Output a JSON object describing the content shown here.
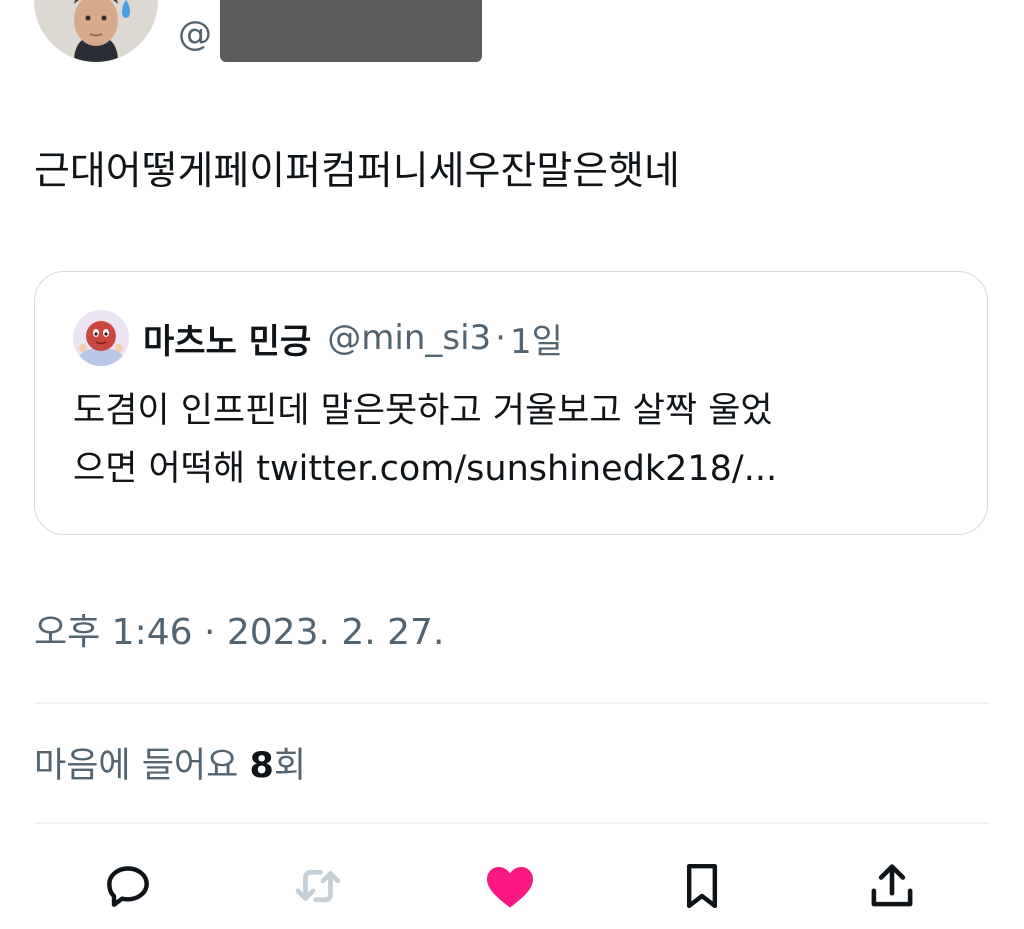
{
  "author": {
    "handle_prefix": "@",
    "avatar_icon": "person-avatar"
  },
  "tweet": {
    "text": "근대어떻게페이퍼컴퍼니세우잔말은햇네"
  },
  "quote": {
    "avatar_icon": "character-avatar",
    "display_name": "마츠노 민긍",
    "handle": "@min_si3",
    "separator": "·",
    "time": "1일",
    "body_lines": [
      "도겸이 인프핀데 말은못하고 거울보고 살짝 울었",
      "으면 어떡해 twitter.com/sunshinedk218/..."
    ]
  },
  "meta": {
    "timestamp": "오후 1:46 · 2023. 2. 27."
  },
  "likes": {
    "label": "마음에 들어요 ",
    "count": "8",
    "suffix": "회"
  },
  "actions": {
    "reply_icon": "reply-icon",
    "retweet_icon": "retweet-icon",
    "like_icon": "heart-icon",
    "bookmark_icon": "bookmark-icon",
    "share_icon": "share-icon"
  },
  "colors": {
    "text_primary": "#0f1419",
    "text_secondary": "#536471",
    "like_active": "#f91880",
    "retweet_disabled": "#c4cfd6",
    "border": "#d5dbe0"
  }
}
